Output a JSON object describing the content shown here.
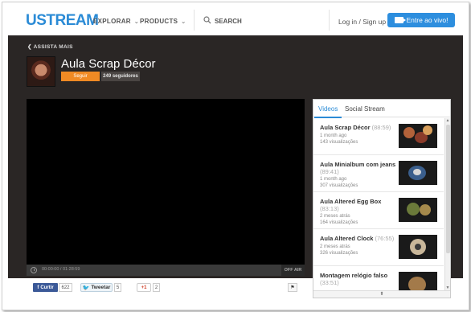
{
  "nav": {
    "logo": "USTREAM",
    "explore": "EXPLORAR",
    "products": "PRODUCTS",
    "search": "SEARCH",
    "login": "Log in / Sign up",
    "live": "Entre ao vivo!"
  },
  "channel": {
    "back": "ASSISTA MAIS",
    "title": "Aula Scrap Décor",
    "follow": "Seguir",
    "followers": "249 seguidores"
  },
  "player": {
    "time": "00:00:00 / 01:28:59",
    "status": "OFF AIR"
  },
  "share": {
    "facebook": "Curtir",
    "facebook_count": "622",
    "twitter": "Tweetar",
    "twitter_count": "5",
    "gplus": "+1",
    "gplus_count": "2",
    "flag": "⚑"
  },
  "sidebar": {
    "tabs": [
      "Videos",
      "Social Stream"
    ],
    "videos": [
      {
        "title": "Aula Scrap Décor",
        "duration": "(88:59)",
        "age": "1 month ago",
        "views": "143 visualizações"
      },
      {
        "title": "Aula Minialbum com jeans",
        "duration": "(89:41)",
        "age": "1 month ago",
        "views": "307 visualizações"
      },
      {
        "title": "Aula Altered Egg Box",
        "duration": "(83:13)",
        "age": "2 meses atrás",
        "views": "164 visualizações"
      },
      {
        "title": "Aula Altered Clock",
        "duration": "(76:55)",
        "age": "2 meses atrás",
        "views": "326 visualizações"
      },
      {
        "title": "Montagem relógio falso",
        "duration": "(33:51)",
        "age": "",
        "views": ""
      }
    ],
    "footer_arrow": "⬍"
  },
  "colors": {
    "accent": "#2b8bd6",
    "follow": "#f08a24",
    "dark_bg": "#2a2625"
  }
}
